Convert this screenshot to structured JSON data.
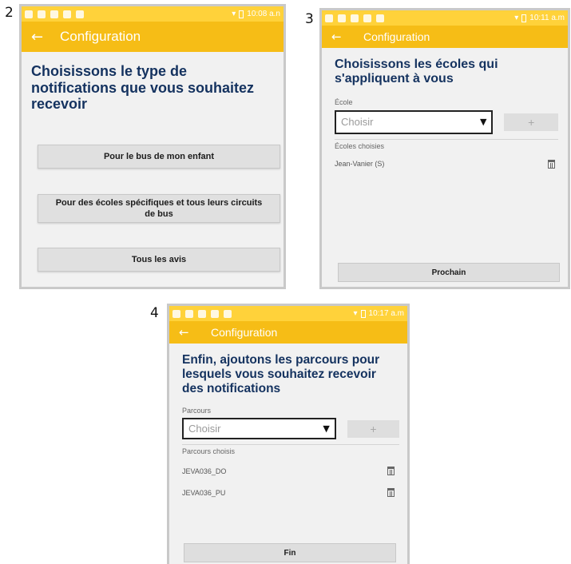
{
  "screens": [
    {
      "step": "2",
      "status_time": "10:08 a.n",
      "app_title": "Configuration",
      "heading": "Choisissons le type de notifications que vous souhaitez recevoir",
      "options": [
        "Pour le bus de mon enfant",
        "Pour des écoles spécifiques et tous leurs circuits de bus",
        "Tous les avis"
      ]
    },
    {
      "step": "3",
      "status_time": "10:11 a.m",
      "app_title": "Configuration",
      "heading": "Choisissons les écoles qui s'appliquent à vous",
      "field_label": "École",
      "select_placeholder": "Choisir",
      "add_label": "+",
      "chosen_label": "Écoles choisies",
      "chosen_items": [
        "Jean-Vanier (S)"
      ],
      "bottom_button": "Prochain"
    },
    {
      "step": "4",
      "status_time": "10:17 a.m",
      "app_title": "Configuration",
      "heading": "Enfin, ajoutons les parcours pour lesquels vous souhaitez recevoir des notifications",
      "field_label": "Parcours",
      "select_placeholder": "Choisir",
      "add_label": "+",
      "chosen_label": "Parcours choisis",
      "chosen_items": [
        "JEVA036_DO",
        "JEVA036_PU"
      ],
      "bottom_button": "Fin"
    }
  ],
  "icons": {
    "back": "arrow-left-icon",
    "dropdown": "caret-down-icon",
    "delete": "trash-icon"
  },
  "colors": {
    "status_bar": "#ffd23a",
    "app_bar": "#f6bd16",
    "heading_text": "#14325f",
    "button_bg": "#e0e0e0"
  }
}
